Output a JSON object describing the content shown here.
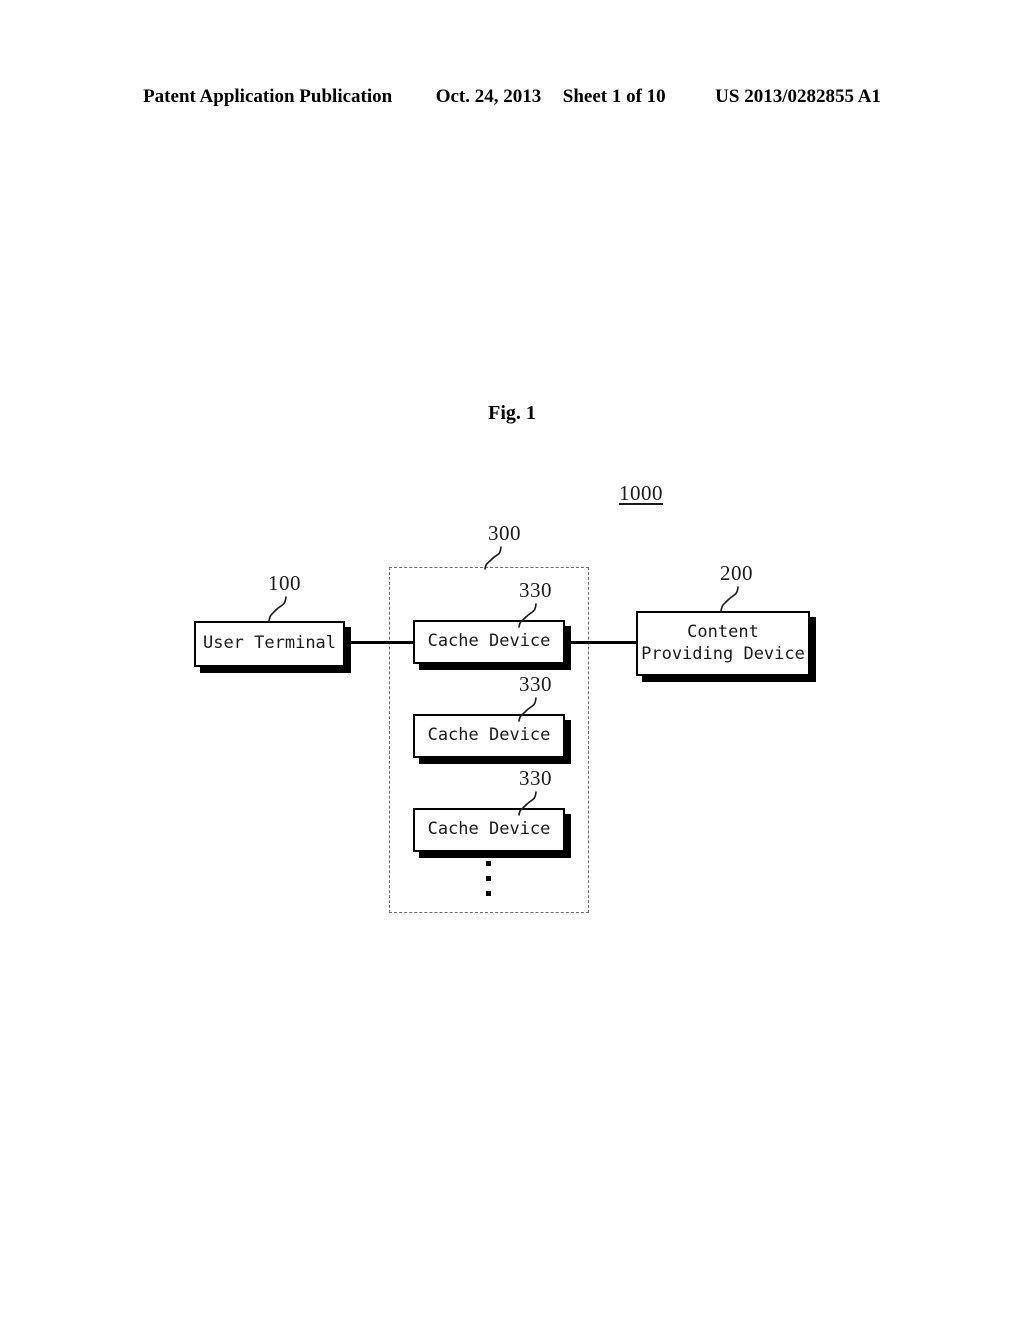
{
  "header": {
    "publication": "Patent Application Publication",
    "date": "Oct. 24, 2013",
    "sheet": "Sheet 1 of 10",
    "patent_number": "US 2013/0282855 A1"
  },
  "figure": {
    "title": "Fig. 1",
    "system_ref": "1000"
  },
  "nodes": {
    "user_terminal": {
      "label": "User  Terminal",
      "ref": "100"
    },
    "content_providing_device": {
      "line1": "Content",
      "line2": "Providing Device",
      "ref": "200"
    },
    "cache_group": {
      "ref": "300"
    },
    "cache_devices": [
      {
        "label": "Cache Device",
        "ref": "330"
      },
      {
        "label": "Cache Device",
        "ref": "330"
      },
      {
        "label": "Cache Device",
        "ref": "330"
      }
    ],
    "continuation": "vertical-ellipsis"
  },
  "colors": {
    "ink": "#000000",
    "dashed_border": "#6b6b6b",
    "background": "#ffffff"
  }
}
